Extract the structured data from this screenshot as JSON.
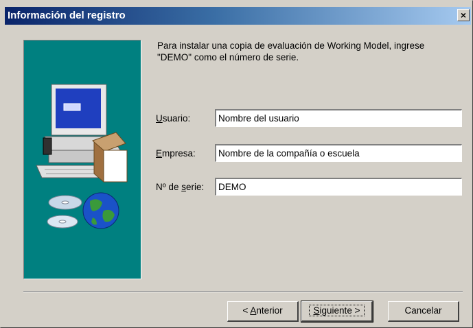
{
  "window": {
    "title": "Información del registro",
    "close_glyph": "×"
  },
  "instructions": "Para instalar una copia de evaluación de Working Model, ingrese \"DEMO\" como el número de serie.",
  "form": {
    "user": {
      "label_key": "U",
      "label_rest": "suario:",
      "value": "Nombre del usuario"
    },
    "company": {
      "label_key": "E",
      "label_rest": "mpresa:",
      "value": "Nombre de la compañía o escuela"
    },
    "serial": {
      "label_prefix": "Nº de ",
      "label_key": "s",
      "label_rest": "erie:",
      "value": "DEMO"
    }
  },
  "buttons": {
    "back": {
      "glyph": "<",
      "key": "A",
      "rest": "nterior"
    },
    "next": {
      "key": "S",
      "rest": "iguiente",
      "glyph": ">"
    },
    "cancel": "Cancelar"
  },
  "colors": {
    "panel": "#008080",
    "dialog": "#d4d0c8",
    "titlebar_start": "#0a246a"
  },
  "icons": {
    "art": "computer-with-cds-and-globe-illustration"
  }
}
